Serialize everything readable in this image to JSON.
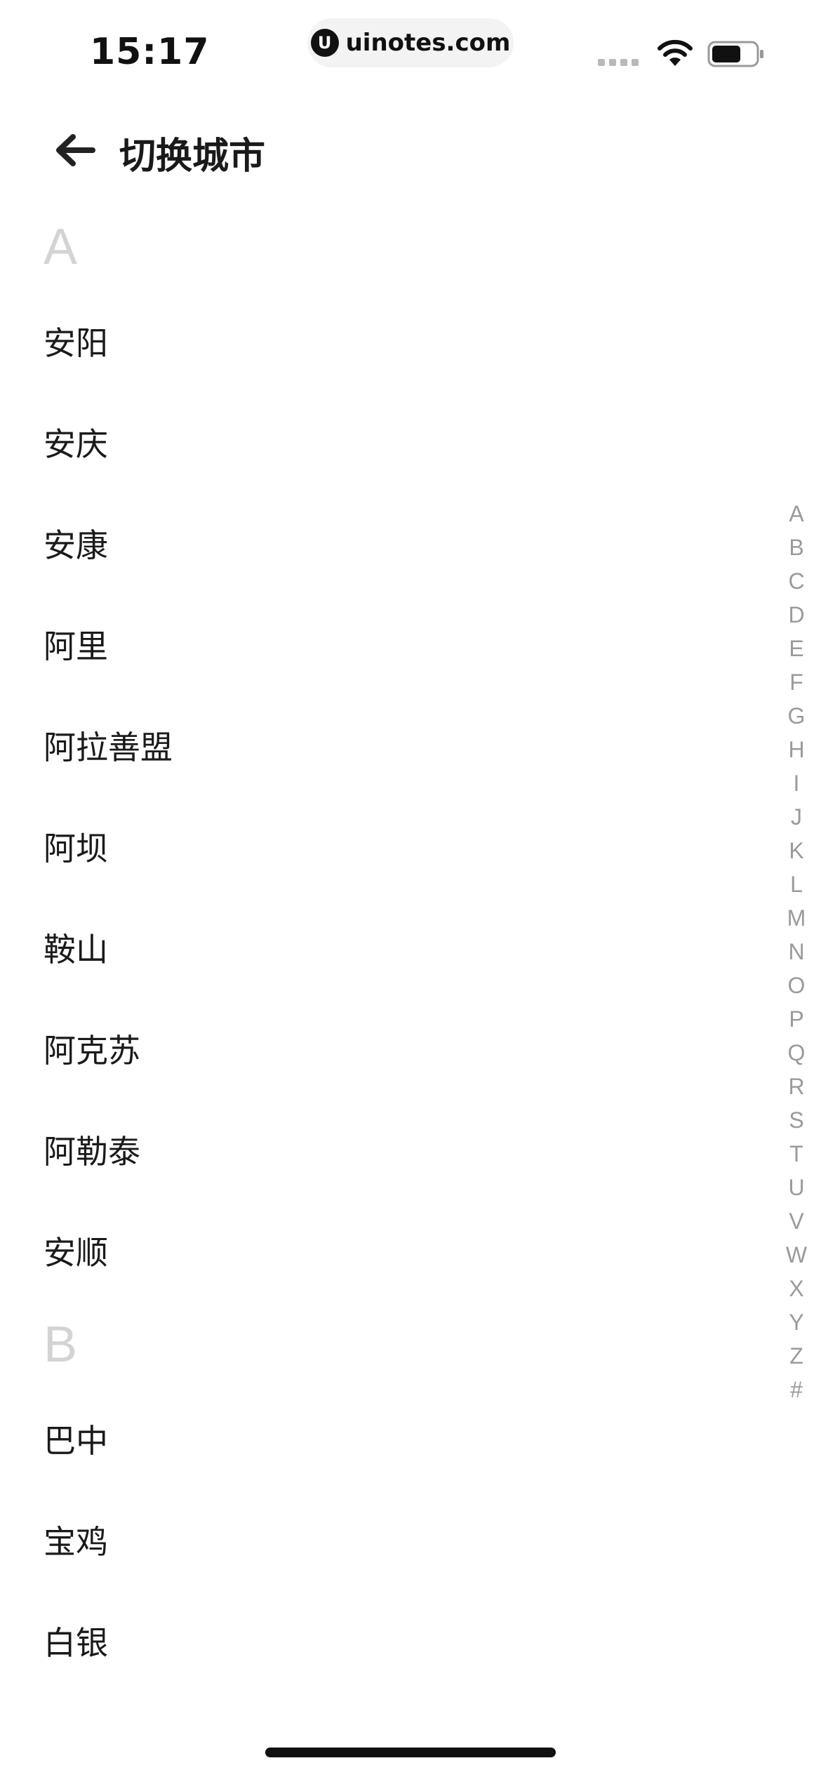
{
  "status": {
    "time": "15:17",
    "url": "uinotes.com",
    "logo_glyph": "U"
  },
  "header": {
    "title": "切换城市",
    "back_icon": "arrow-left-icon"
  },
  "sections": [
    {
      "letter": "A",
      "cities": [
        "安阳",
        "安庆",
        "安康",
        "阿里",
        "阿拉善盟",
        "阿坝",
        "鞍山",
        "阿克苏",
        "阿勒泰",
        "安顺"
      ]
    },
    {
      "letter": "B",
      "cities": [
        "巴中",
        "宝鸡",
        "白银"
      ]
    }
  ],
  "alpha_index": [
    "A",
    "B",
    "C",
    "D",
    "E",
    "F",
    "G",
    "H",
    "I",
    "J",
    "K",
    "L",
    "M",
    "N",
    "O",
    "P",
    "Q",
    "R",
    "S",
    "T",
    "U",
    "V",
    "W",
    "X",
    "Y",
    "Z",
    "#"
  ],
  "colors": {
    "section_letter": "#d3d3d3",
    "index_letter": "#9a9a9a",
    "text": "#1a1a1a"
  }
}
